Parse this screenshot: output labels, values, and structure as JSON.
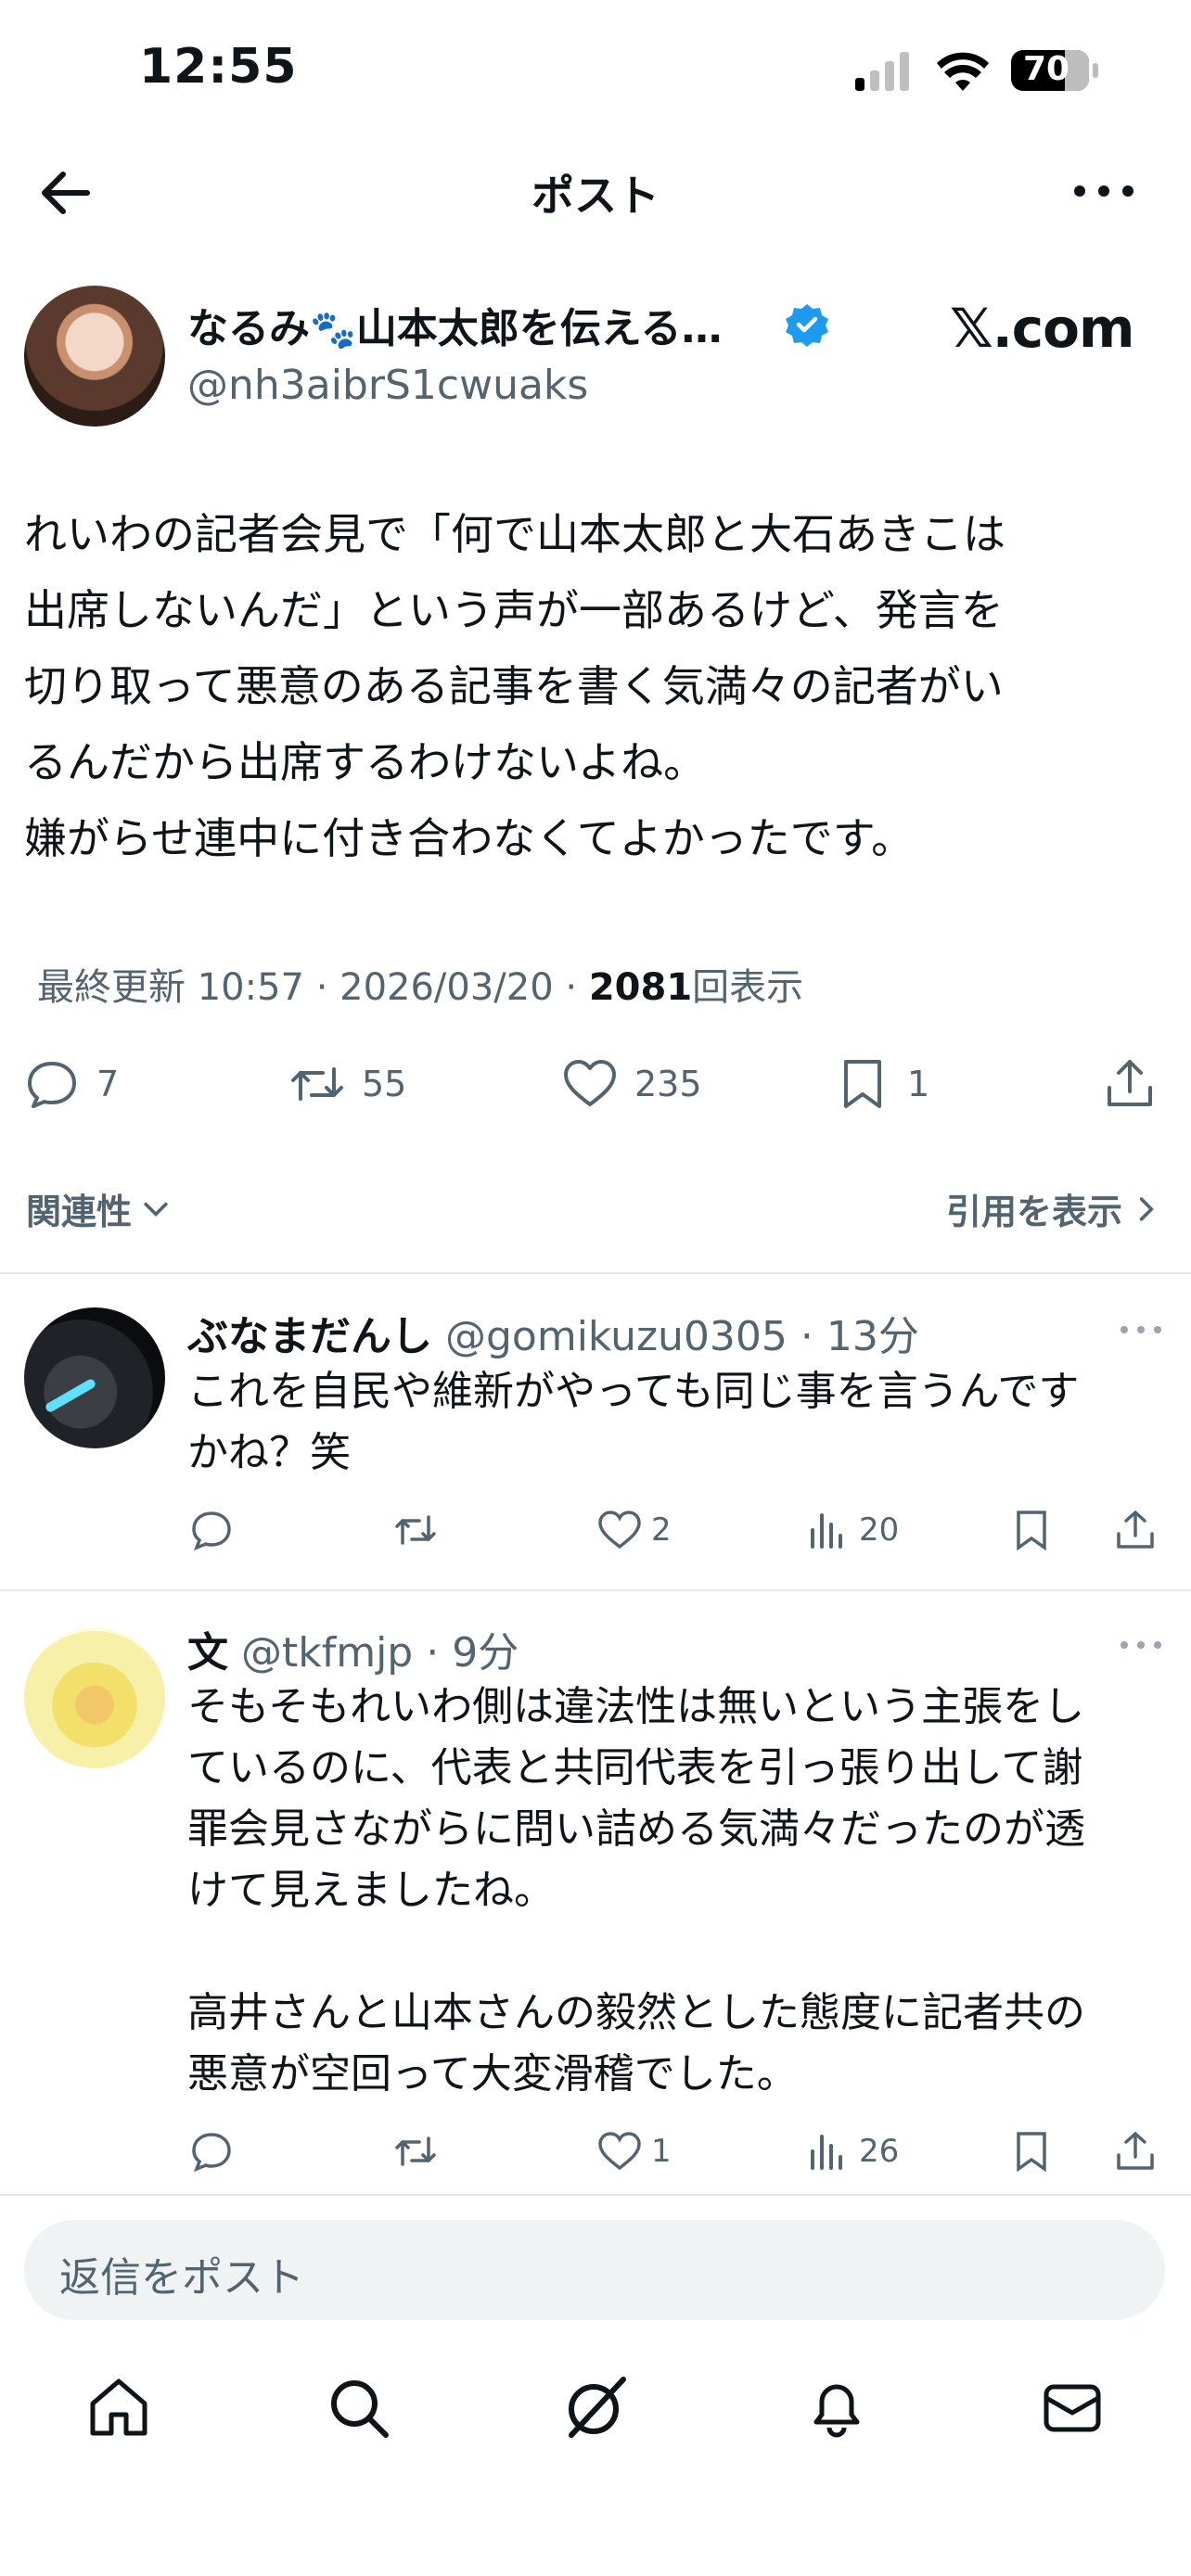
{
  "status_bar": {
    "time": "12:55",
    "battery": "70"
  },
  "header": {
    "title": "ポスト"
  },
  "post": {
    "author_name": "なるみ",
    "author_name_paw": "🐾",
    "author_name_rest": "山本太郎を伝える…",
    "author_handle": "@nh3aibrS1cwuaks",
    "source_label": "𝕏.com",
    "text": "れいわの記者会見で「何で山本太郎と大石あきこは\n出席しないんだ」という声が一部あるけど、発言を\n切り取って悪意のある記事を書く気満々の記者がい\nるんだから出席するわけないよね。\n嫌がらせ連中に付き合わなくてよかったです。",
    "meta_prefix": "最終更新 10:57 · 2026/03/20 · ",
    "views_count": "2081",
    "views_label": "回表示",
    "stats": {
      "replies": "7",
      "reposts": "55",
      "likes": "235",
      "bookmarks": "1"
    }
  },
  "filters": {
    "relevance_label": "関連性",
    "quotes_label": "引用を表示"
  },
  "replies": [
    {
      "name": "ぶなまだんし",
      "handle": "@gomikuzu0305 · 13分",
      "text": "これを自民や維新がやっても同じ事を言うんです\nかね？笑",
      "likes": "2",
      "views": "20"
    },
    {
      "name": "文",
      "handle": "@tkfmjp · 9分",
      "text": "そもそもれいわ側は違法性は無いという主張をし\nているのに、代表と共同代表を引っ張り出して謝\n罪会見さながらに問い詰める気満々だったのが透\nけて見えましたね。\n\n高井さんと山本さんの毅然とした態度に記者共の\n悪意が空回って大変滑稽でした。",
      "likes": "1",
      "views": "26"
    }
  ],
  "composer": {
    "placeholder": "返信をポスト"
  },
  "colors": {
    "accent": "#1d9bf0",
    "muted": "#536471",
    "text": "#0f1419"
  }
}
